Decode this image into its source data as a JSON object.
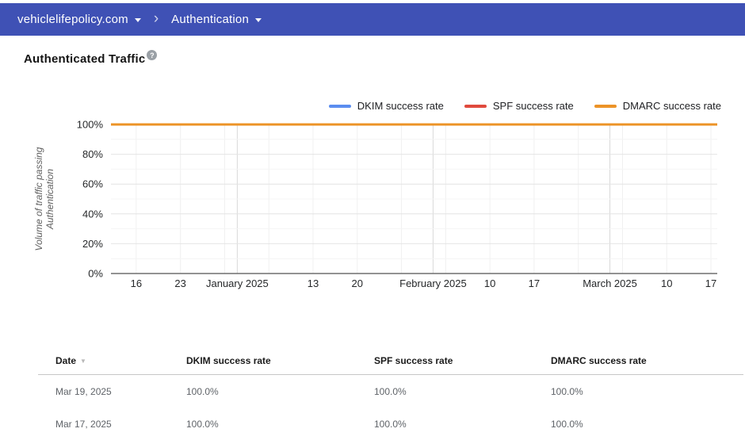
{
  "header": {
    "domain": "vehiclelifepolicy.com",
    "section": "Authentication",
    "separator": "›"
  },
  "page": {
    "title": "Authenticated Traffic",
    "help_icon": "?"
  },
  "chart_data": {
    "type": "line",
    "title": "Authenticated Traffic",
    "ylabel": "Volume of traffic passing Authentication",
    "ylabel_lines": [
      "Volume of traffic passing",
      "Authentication"
    ],
    "ylim": [
      0,
      100
    ],
    "grid": true,
    "legend_position": "top-right",
    "y_ticks": [
      {
        "value": 0,
        "label": "0%"
      },
      {
        "value": 20,
        "label": "20%"
      },
      {
        "value": 40,
        "label": "40%"
      },
      {
        "value": 60,
        "label": "60%"
      },
      {
        "value": 80,
        "label": "80%"
      },
      {
        "value": 100,
        "label": "100%"
      }
    ],
    "x_domain": [
      "2024-12-12",
      "2025-03-18"
    ],
    "x_ticks": [
      {
        "date": "2024-12-16",
        "label": "16"
      },
      {
        "date": "2024-12-23",
        "label": "23"
      },
      {
        "date": "2025-01-01",
        "label": "January 2025"
      },
      {
        "date": "2025-01-13",
        "label": "13"
      },
      {
        "date": "2025-01-20",
        "label": "20"
      },
      {
        "date": "2025-02-01",
        "label": "February 2025"
      },
      {
        "date": "2025-02-10",
        "label": "10"
      },
      {
        "date": "2025-02-17",
        "label": "17"
      },
      {
        "date": "2025-03-01",
        "label": "March 2025"
      },
      {
        "date": "2025-03-10",
        "label": "10"
      },
      {
        "date": "2025-03-17",
        "label": "17"
      }
    ],
    "weekly_gridlines": [
      "2024-12-16",
      "2024-12-23",
      "2024-12-30",
      "2025-01-06",
      "2025-01-13",
      "2025-01-20",
      "2025-01-27",
      "2025-02-03",
      "2025-02-10",
      "2025-02-17",
      "2025-02-24",
      "2025-03-03",
      "2025-03-10",
      "2025-03-17"
    ],
    "month_gridlines": [
      "2025-01-01",
      "2025-02-01",
      "2025-03-01"
    ],
    "series": [
      {
        "name": "DKIM success rate",
        "color": "#5b8def",
        "points": [
          {
            "date": "2024-12-12",
            "value": 100
          },
          {
            "date": "2025-03-18",
            "value": 100
          }
        ]
      },
      {
        "name": "SPF success rate",
        "color": "#e04a3d",
        "points": [
          {
            "date": "2024-12-12",
            "value": 100
          },
          {
            "date": "2025-03-18",
            "value": 100
          }
        ]
      },
      {
        "name": "DMARC success rate",
        "color": "#ec9327",
        "points": [
          {
            "date": "2024-12-12",
            "value": 100
          },
          {
            "date": "2025-03-18",
            "value": 100
          }
        ]
      }
    ]
  },
  "table": {
    "columns": [
      "Date",
      "DKIM success rate",
      "SPF success rate",
      "DMARC success rate"
    ],
    "sort_icon": "▼",
    "rows": [
      [
        "Mar 19, 2025",
        "100.0%",
        "100.0%",
        "100.0%"
      ],
      [
        "Mar 17, 2025",
        "100.0%",
        "100.0%",
        "100.0%"
      ]
    ]
  },
  "colors": {
    "header_bar": "#3f51b5",
    "dkim": "#5b8def",
    "spf": "#e04a3d",
    "dmarc": "#ec9327"
  }
}
